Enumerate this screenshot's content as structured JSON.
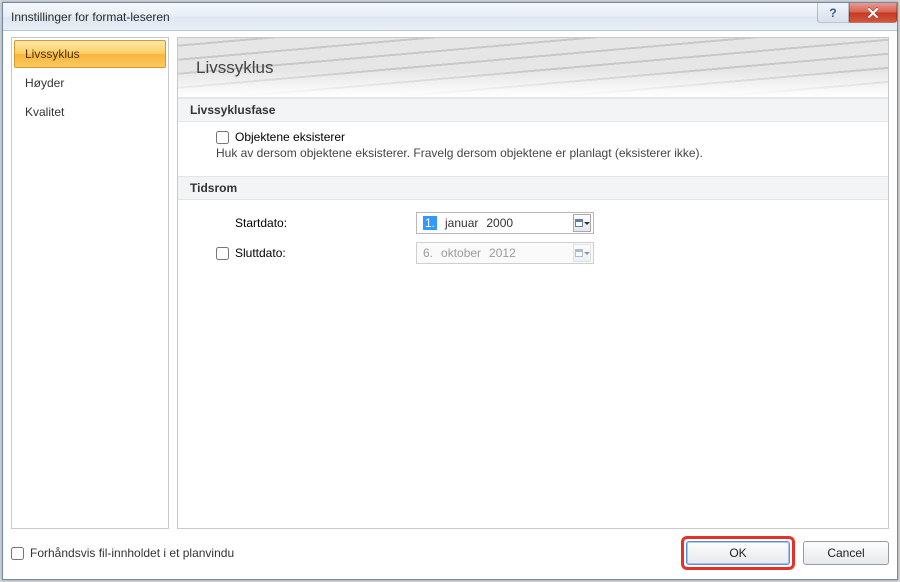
{
  "window": {
    "title": "Innstillinger for format-leseren"
  },
  "sidebar": {
    "items": [
      {
        "label": "Livssyklus",
        "selected": true
      },
      {
        "label": "Høyder",
        "selected": false
      },
      {
        "label": "Kvalitet",
        "selected": false
      }
    ]
  },
  "main": {
    "heading": "Livssyklus",
    "sections": {
      "phase": {
        "title": "Livssyklusfase",
        "checkbox_label": "Objektene eksisterer",
        "checkbox_checked": false,
        "hint": "Huk av dersom objektene eksisterer. Fravelg dersom objektene er planlagt (eksisterer ikke)."
      },
      "timespan": {
        "title": "Tidsrom",
        "start": {
          "label": "Startdato:",
          "day": "1.",
          "month": "januar",
          "year": "2000",
          "enabled": true
        },
        "end": {
          "label": "Sluttdato:",
          "checkbox_checked": false,
          "day": "6.",
          "month": "oktober",
          "year": "2012",
          "enabled": false
        }
      }
    }
  },
  "footer": {
    "preview_label": "Forhåndsvis fil-innholdet i et planvindu",
    "preview_checked": false,
    "ok_label": "OK",
    "cancel_label": "Cancel"
  }
}
